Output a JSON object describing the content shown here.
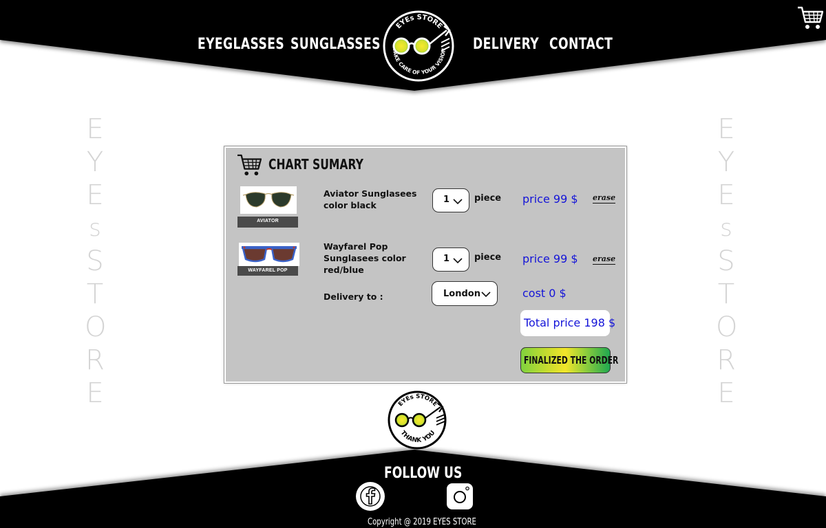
{
  "nav": {
    "eyeglasses": "EYEGLASSES",
    "sunglasses": "SUNGLASSES",
    "delivery": "DELIVERY",
    "contact": "CONTACT"
  },
  "logo": {
    "top_text": "EYEs STORE",
    "bottom_text": "TAKE CARE OF YOUR VISION"
  },
  "side_text": [
    "E",
    "Y",
    "E",
    "s",
    "S",
    "T",
    "O",
    "R",
    "E"
  ],
  "cart": {
    "title": "CHART SUMARY",
    "items": [
      {
        "thumb_caption": "AVIATOR",
        "name": "Aviator Sunglasees color black",
        "quantity": "1",
        "unit": "piece",
        "price": "price 99 $",
        "erase": "erase"
      },
      {
        "thumb_caption": "WAYFAREL POP",
        "name": "Wayfarel Pop Sunglasees color red/blue",
        "quantity": "1",
        "unit": "piece",
        "price": "price 99 $",
        "erase": "erase"
      }
    ],
    "delivery_label": "Delivery to :",
    "delivery_city": "London",
    "delivery_cost": "cost 0 $",
    "total": "Total price 198 $",
    "finalize": "FINALIZED THE ORDER"
  },
  "thank_logo": {
    "top_text": "EYEs STORE",
    "bottom_text": "THANK YOU"
  },
  "footer": {
    "follow": "FOLLOW US",
    "copyright": "Copyright @ 2019 EYES STORE"
  },
  "colors": {
    "header": "#000000",
    "panel": "#c4c4c4",
    "price": "#1414d8",
    "lens_yellow": "#f2e52a",
    "lens_green": "#3cc04a"
  },
  "icons": [
    "cart-icon",
    "facebook-icon",
    "instagram-icon"
  ]
}
